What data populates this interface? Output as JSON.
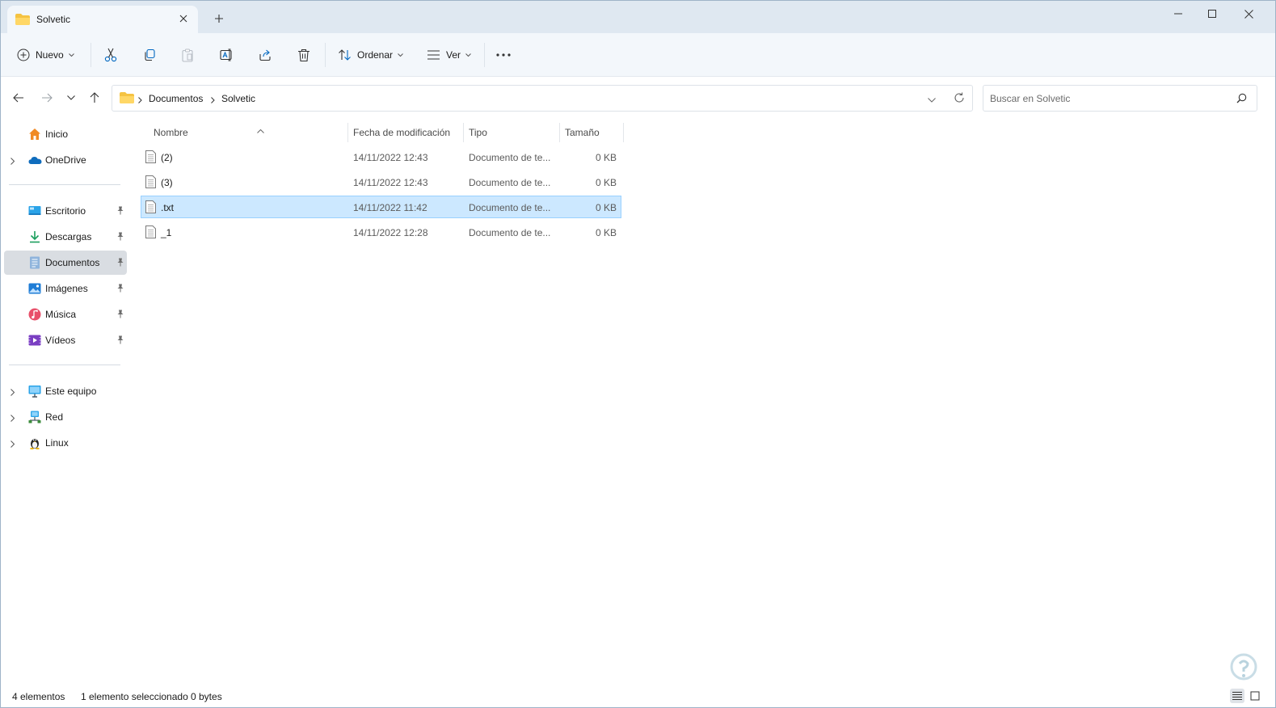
{
  "window": {
    "tab_title": "Solvetic"
  },
  "toolbar": {
    "new_label": "Nuevo",
    "sort_label": "Ordenar",
    "view_label": "Ver"
  },
  "address": {
    "crumbs": [
      "Documentos",
      "Solvetic"
    ]
  },
  "search": {
    "placeholder": "Buscar en Solvetic"
  },
  "sidebar": {
    "top": [
      {
        "label": "Inicio",
        "icon": "home-icon"
      },
      {
        "label": "OneDrive",
        "icon": "cloud-icon"
      }
    ],
    "quick_access": [
      {
        "label": "Escritorio",
        "icon": "desktop-icon"
      },
      {
        "label": "Descargas",
        "icon": "download-icon"
      },
      {
        "label": "Documentos",
        "icon": "documents-icon",
        "active": true
      },
      {
        "label": "Imágenes",
        "icon": "pictures-icon"
      },
      {
        "label": "Música",
        "icon": "music-icon"
      },
      {
        "label": "Vídeos",
        "icon": "videos-icon"
      }
    ],
    "locations": [
      {
        "label": "Este equipo",
        "icon": "computer-icon"
      },
      {
        "label": "Red",
        "icon": "network-icon"
      },
      {
        "label": "Linux",
        "icon": "linux-icon"
      }
    ]
  },
  "columns": {
    "name": "Nombre",
    "date": "Fecha de modificación",
    "type": "Tipo",
    "size": "Tamaño"
  },
  "files": [
    {
      "name": "(2)",
      "date": "14/11/2022 12:43",
      "type": "Documento de te...",
      "size": "0 KB"
    },
    {
      "name": "(3)",
      "date": "14/11/2022 12:43",
      "type": "Documento de te...",
      "size": "0 KB"
    },
    {
      "name": ".txt",
      "date": "14/11/2022 11:42",
      "type": "Documento de te...",
      "size": "0 KB",
      "selected": true
    },
    {
      "name": "_1",
      "date": "14/11/2022 12:28",
      "type": "Documento de te...",
      "size": "0 KB"
    }
  ],
  "status": {
    "count": "4 elementos",
    "selection": "1 elemento seleccionado",
    "size": "0 bytes"
  },
  "colors": {
    "titlebar": "#dfe8f1",
    "commandbar": "#f3f7fb",
    "selection_fill": "#cce8ff",
    "selection_border": "#99d1ff",
    "accent": "#0067c0"
  }
}
